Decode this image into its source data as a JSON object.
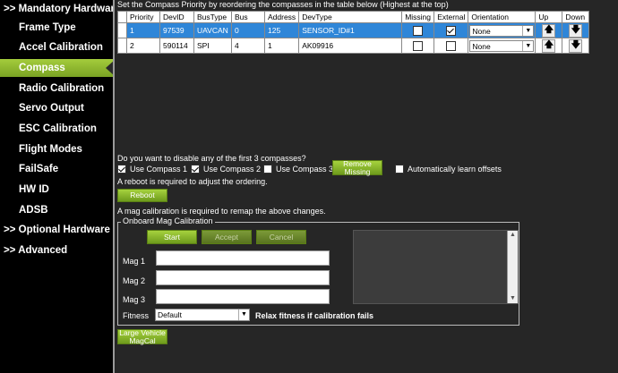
{
  "sidebar": {
    "groups": {
      "mandatory": ">> Mandatory Hardware",
      "optional": ">> Optional Hardware",
      "advanced": ">> Advanced"
    },
    "items": [
      {
        "label": "Frame Type"
      },
      {
        "label": "Accel Calibration"
      },
      {
        "label": "Compass"
      },
      {
        "label": "Radio Calibration"
      },
      {
        "label": "Servo Output"
      },
      {
        "label": "ESC Calibration"
      },
      {
        "label": "Flight Modes"
      },
      {
        "label": "FailSafe"
      },
      {
        "label": "HW ID"
      },
      {
        "label": "ADSB"
      }
    ],
    "active_item": "Compass"
  },
  "header_text": "Set the Compass Priority by reordering the compasses in the table below (Highest at the top)",
  "table": {
    "columns": [
      "Priority",
      "DevID",
      "BusType",
      "Bus",
      "Address",
      "DevType",
      "Missing",
      "External",
      "Orientation",
      "Up",
      "Down"
    ],
    "rows": [
      {
        "priority": "1",
        "devid": "97539",
        "bustype": "UAVCAN",
        "bus": "0",
        "address": "125",
        "devtype": "SENSOR_ID#1",
        "missing": false,
        "external": true,
        "orientation": "None",
        "selected": true
      },
      {
        "priority": "2",
        "devid": "590114",
        "bustype": "SPI",
        "bus": "4",
        "address": "1",
        "devtype": "AK09916",
        "missing": false,
        "external": false,
        "orientation": "None",
        "selected": false
      }
    ]
  },
  "disable_question": "Do you want to disable any of the first 3 compasses?",
  "use_compass": [
    {
      "label": "Use Compass 1",
      "checked": true
    },
    {
      "label": "Use Compass 2",
      "checked": true
    },
    {
      "label": "Use Compass 3",
      "checked": false
    }
  ],
  "remove_missing_label": "Remove Missing",
  "auto_learn": {
    "label": "Automatically learn offsets",
    "checked": false
  },
  "reboot_note": "A reboot is required to adjust the ordering.",
  "reboot_label": "Reboot",
  "mag_cal_note": "A mag calibration is required to remap the above changes.",
  "onboard": {
    "title": "Onboard Mag Calibration",
    "start_label": "Start",
    "accept_label": "Accept",
    "cancel_label": "Cancel",
    "mags": [
      "Mag 1",
      "Mag 2",
      "Mag 3"
    ],
    "fitness_label": "Fitness",
    "fitness_value": "Default",
    "relax_label": "Relax fitness if calibration fails"
  },
  "large_vehicle_label": "Large Vehicle MagCal",
  "colors": {
    "accent": "#8cc43a",
    "selected_row": "#2f86d8",
    "background": "#262626"
  }
}
